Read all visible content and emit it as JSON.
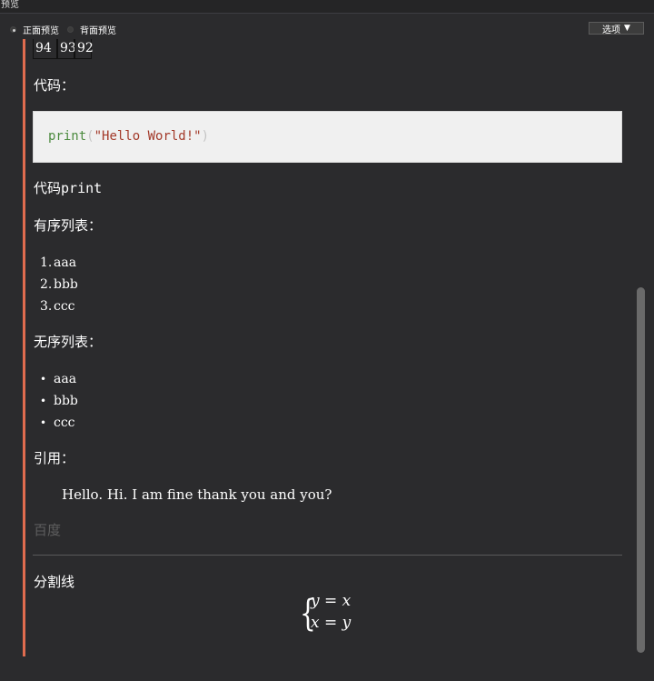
{
  "window": {
    "title": "预览"
  },
  "toolbar": {
    "front_preview": "正面预览",
    "back_preview": "背面预览",
    "options_label": "选项",
    "options_caret": "▼"
  },
  "table": {
    "cells": [
      "94",
      "93",
      "92"
    ]
  },
  "content": {
    "code_heading": "代码：",
    "code": {
      "keyword": "print",
      "open_paren": "(",
      "string": "\"Hello World!\"",
      "close_paren": ")"
    },
    "inline_code_prefix": "代码",
    "inline_code": "print",
    "ordered_heading": "有序列表：",
    "ordered_items": [
      "aaa",
      "bbb",
      "ccc"
    ],
    "ordered_markers": [
      "1.",
      "2.",
      "3."
    ],
    "unordered_heading": "无序列表：",
    "unordered_items": [
      "aaa",
      "bbb",
      "ccc"
    ],
    "bullet": "•",
    "quote_heading": "引用：",
    "quote_text": "Hello. Hi. I am fine thank you and you?",
    "link_text": "百度",
    "divider_heading": "分割线",
    "math": {
      "brace": "{",
      "line1": "y = x",
      "line2": "x = y"
    }
  }
}
